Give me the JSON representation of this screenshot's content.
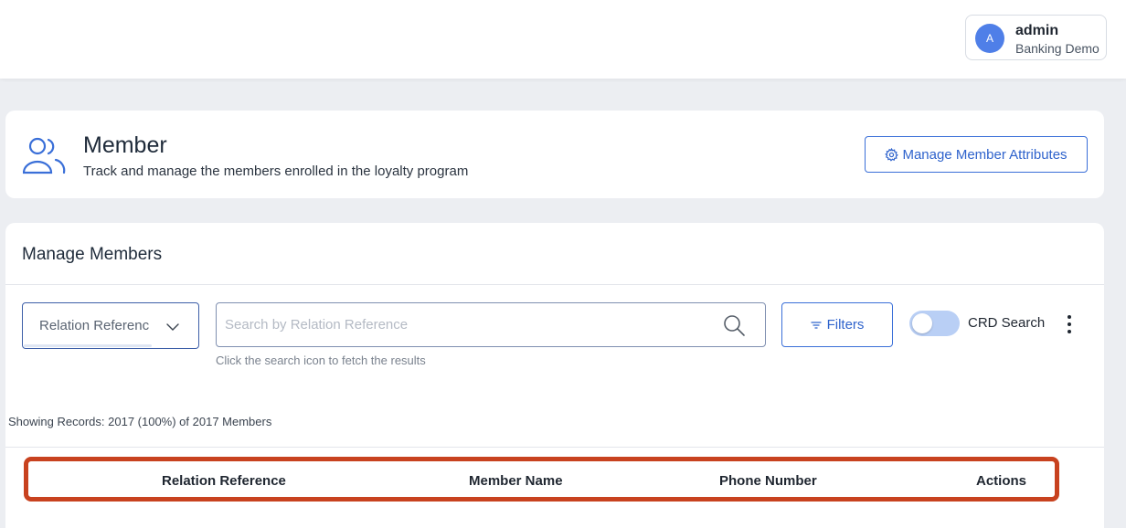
{
  "header": {
    "user": {
      "avatar_letter": "A",
      "name": "admin",
      "org": "Banking Demo"
    }
  },
  "member_card": {
    "title": "Member",
    "subtitle": "Track and manage the members enrolled in the loyalty program",
    "attributes_button": "Manage Member Attributes",
    "icon": "users-icon"
  },
  "manage": {
    "title": "Manage Members",
    "search_field_select": "Relation Referenc",
    "search_placeholder": "Search by Relation Reference",
    "search_hint": "Click the search icon to fetch the results",
    "filters_button": "Filters",
    "crd_search_label": "CRD Search",
    "crd_search_enabled": false,
    "records_label": "Showing Records:",
    "records_value": "2017 (100%) of 2017 Members"
  },
  "table": {
    "columns": [
      "Relation Reference",
      "Member Name",
      "Phone Number",
      "Actions"
    ]
  },
  "colors": {
    "accent": "#2f63cc",
    "avatar": "#4f7fe8",
    "highlight_border": "#c8421f"
  }
}
